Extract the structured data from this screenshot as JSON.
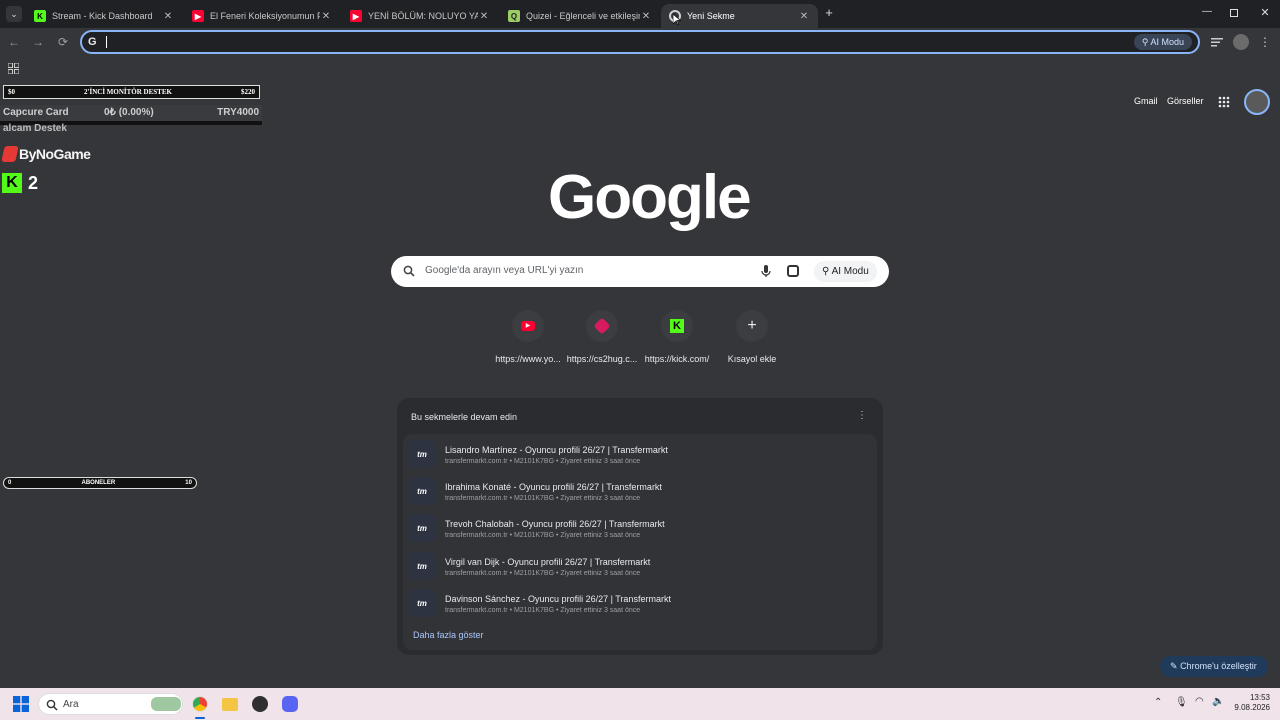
{
  "tabs": [
    {
      "title": "Stream - Kick Dashboard",
      "favicon": "kick-icon",
      "color": "#53fc18"
    },
    {
      "title": "El Feneri Koleksiyonumun Favori",
      "favicon": "youtube-icon",
      "color": "#ff0033"
    },
    {
      "title": "YENİ BÖLÜM: NOLUYO YA ¿ VS",
      "favicon": "youtube-icon",
      "color": "#ff0033"
    },
    {
      "title": "Quizei - Eğlenceli ve etkileşimli",
      "favicon": "quizei-icon",
      "color": "#9ccc65"
    },
    {
      "title": "Yeni Sekme",
      "favicon": "chrome-icon",
      "color": "#e8eaed"
    }
  ],
  "toolbar": {
    "omnibox_value": "",
    "ai_mode": "AI Modu"
  },
  "overlays": {
    "goal_bar": {
      "left": "$0",
      "title": "2'İNCİ MONİTÖR DESTEK",
      "right": "$220"
    },
    "capture": {
      "label": "Capcure Card",
      "value": "0₺ (0.00%)",
      "target": "TRY4000"
    },
    "alcam": "alcam Destek",
    "bynogame": "ByNoGame",
    "kick_count": "2",
    "sub_bar": {
      "left": "0",
      "title": "ABONELER",
      "right": "10"
    }
  },
  "header_links": {
    "gmail": "Gmail",
    "images": "Görseller"
  },
  "logo": "Google",
  "search": {
    "placeholder": "Google'da arayın veya URL'yi yazın",
    "ai_mode": "AI Modu"
  },
  "shortcuts": [
    {
      "label": "https://www.yo...",
      "icon": "youtube-icon"
    },
    {
      "label": "https://cs2hug.c...",
      "icon": "cs2hug-icon"
    },
    {
      "label": "https://kick.com/",
      "icon": "kick-icon"
    },
    {
      "label": "Kısayol ekle",
      "icon": "plus-icon"
    }
  ],
  "continue": {
    "heading": "Bu sekmelerle devam edin",
    "items": [
      {
        "title": "Lisandro Martínez - Oyuncu profili 26/27 | Transfermarkt",
        "meta": "transfermarkt.com.tr • M2101K7BG • Ziyaret ettiniz 3 saat önce"
      },
      {
        "title": "Ibrahima Konaté - Oyuncu profili 26/27 | Transfermarkt",
        "meta": "transfermarkt.com.tr • M2101K7BG • Ziyaret ettiniz 3 saat önce"
      },
      {
        "title": "Trevoh Chalobah - Oyuncu profili 26/27 | Transfermarkt",
        "meta": "transfermarkt.com.tr • M2101K7BG • Ziyaret ettiniz 3 saat önce"
      },
      {
        "title": "Virgil van Dijk - Oyuncu profili 26/27 | Transfermarkt",
        "meta": "transfermarkt.com.tr • M2101K7BG • Ziyaret ettiniz 3 saat önce"
      },
      {
        "title": "Davinson Sánchez - Oyuncu profili 26/27 | Transfermarkt",
        "meta": "transfermarkt.com.tr • M2101K7BG • Ziyaret ettiniz 3 saat önce"
      }
    ],
    "more": "Daha fazla göster"
  },
  "customize": "Chrome'u özelleştir",
  "taskbar": {
    "search_placeholder": "Ara",
    "time": "13:53",
    "date": "9.08.2026"
  }
}
